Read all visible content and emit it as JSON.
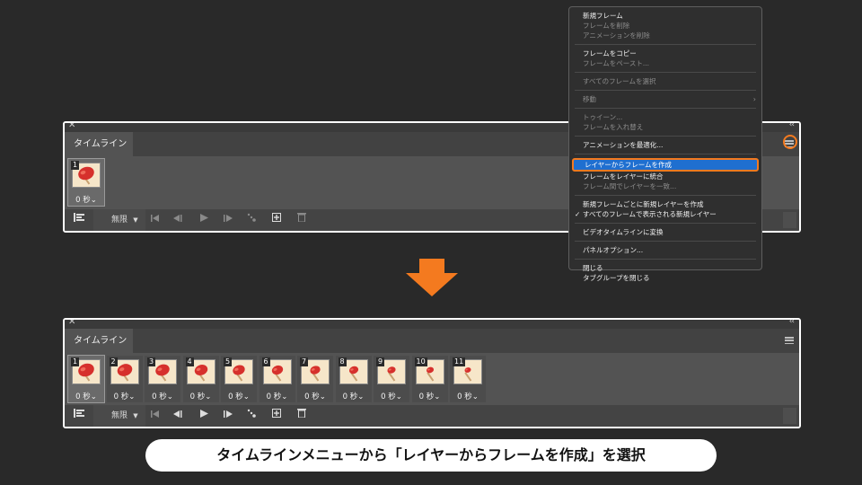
{
  "colors": {
    "accent_orange": "#f47a1f",
    "highlight_blue": "#1f6fd0",
    "panel_bg": "#535353",
    "page_bg": "#292929"
  },
  "icons": [
    "close-icon",
    "collapse-icon",
    "panel-menu-icon",
    "convert-icon",
    "dropdown-caret-icon",
    "first-frame-icon",
    "prev-frame-icon",
    "play-icon",
    "next-frame-icon",
    "tween-icon",
    "duplicate-frame-icon",
    "trash-icon",
    "arrow-down-icon"
  ],
  "top_panel": {
    "tab_label": "タイムライン",
    "frames": [
      {
        "num": "1",
        "duration": "0 秒"
      }
    ],
    "loop_value": "無限"
  },
  "bottom_panel": {
    "tab_label": "タイムライン",
    "frames": [
      {
        "num": "1",
        "duration": "0 秒"
      },
      {
        "num": "2",
        "duration": "0 秒"
      },
      {
        "num": "3",
        "duration": "0 秒"
      },
      {
        "num": "4",
        "duration": "0 秒"
      },
      {
        "num": "5",
        "duration": "0 秒"
      },
      {
        "num": "6",
        "duration": "0 秒"
      },
      {
        "num": "7",
        "duration": "0 秒"
      },
      {
        "num": "8",
        "duration": "0 秒"
      },
      {
        "num": "9",
        "duration": "0 秒"
      },
      {
        "num": "10",
        "duration": "0 秒"
      },
      {
        "num": "11",
        "duration": "0 秒"
      }
    ],
    "loop_value": "無限"
  },
  "menu": {
    "items": [
      {
        "label": "新規フレーム"
      },
      {
        "label": "フレームを削除"
      },
      {
        "label": "アニメーションを削除"
      },
      {
        "label": "フレームをコピー"
      },
      {
        "label": "フレームをペースト..."
      },
      {
        "label": "すべてのフレームを選択"
      },
      {
        "label": "移動"
      },
      {
        "label": "トゥイーン..."
      },
      {
        "label": "フレームを入れ替え"
      },
      {
        "label": "アニメーションを最適化..."
      },
      {
        "label": "レイヤーからフレームを作成"
      },
      {
        "label": "フレームをレイヤーに統合"
      },
      {
        "label": "フレーム間でレイヤーを一致..."
      },
      {
        "label": "新規フレームごとに新規レイヤーを作成"
      },
      {
        "label": "すべてのフレームで表示される新規レイヤー"
      },
      {
        "label": "ビデオタイムラインに変換"
      },
      {
        "label": "パネルオプション..."
      },
      {
        "label": "閉じる"
      },
      {
        "label": "タブグループを閉じる"
      }
    ]
  },
  "caption": "タイムラインメニューから「レイヤーからフレームを作成」を選択"
}
